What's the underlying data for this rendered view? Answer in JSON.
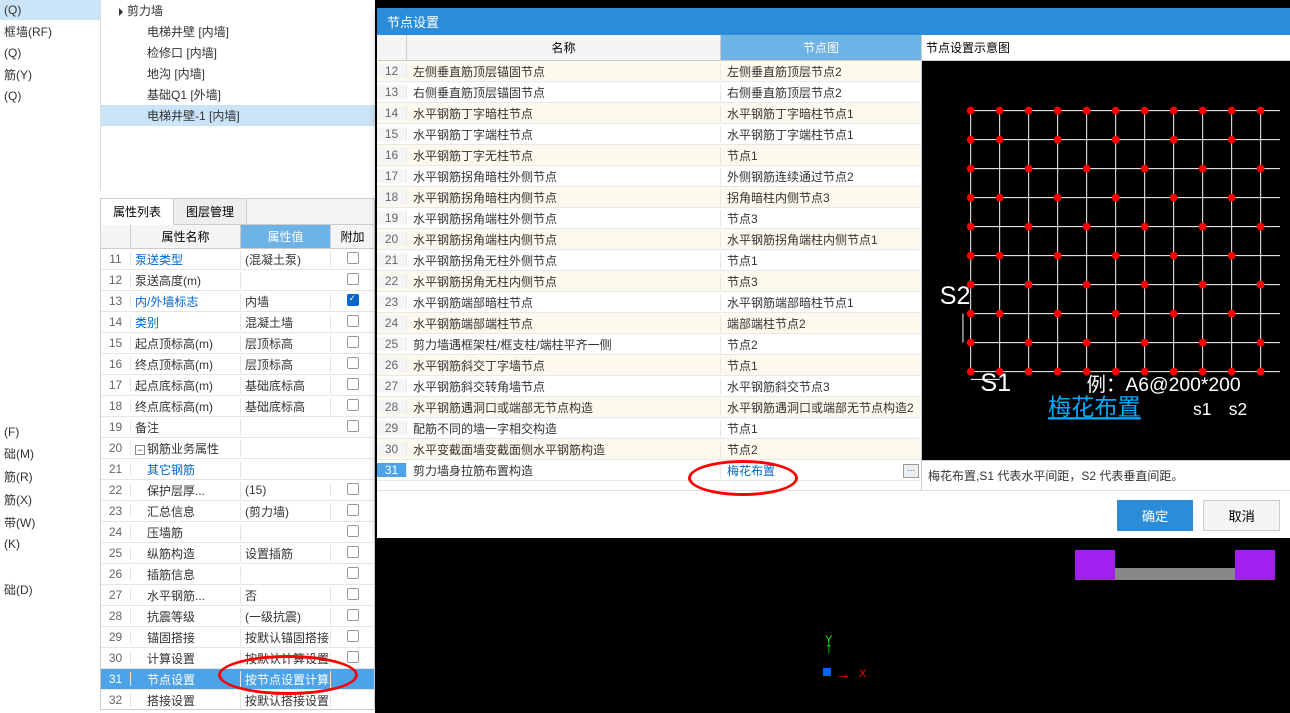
{
  "left_sidebar": {
    "items": [
      {
        "label": "(Q)",
        "sel": true
      },
      {
        "label": "框墙(RF)"
      },
      {
        "label": "(Q)"
      },
      {
        "label": "筋(Y)"
      },
      {
        "label": "(Q)"
      },
      {
        "label": ""
      },
      {
        "label": "(F)"
      },
      {
        "label": "础(M)"
      },
      {
        "label": "筋(R)"
      },
      {
        "label": "筋(X)"
      },
      {
        "label": "带(W)"
      },
      {
        "label": "(K)"
      },
      {
        "label": ""
      },
      {
        "label": "础(D)"
      }
    ]
  },
  "tree": {
    "root": "剪力墙",
    "children": [
      {
        "label": "电梯井壁 [内墙]"
      },
      {
        "label": "检修口 [内墙]"
      },
      {
        "label": "地沟 [内墙]"
      },
      {
        "label": "基础Q1 [外墙]"
      },
      {
        "label": "电梯井壁-1 [内墙]",
        "sel": true
      }
    ]
  },
  "prop_tabs": {
    "t1": "属性列表",
    "t2": "图层管理"
  },
  "prop_header": {
    "name": "属性名称",
    "value": "属性值",
    "extra": "附加"
  },
  "prop_rows": [
    {
      "n": "11",
      "name": "泵送类型",
      "val": "(混凝土泵)",
      "blue": true,
      "chk": false
    },
    {
      "n": "12",
      "name": "泵送高度(m)",
      "val": "",
      "chk": false
    },
    {
      "n": "13",
      "name": "内/外墙标志",
      "val": "内墙",
      "blue": true,
      "chk": true
    },
    {
      "n": "14",
      "name": "类别",
      "val": "混凝土墙",
      "blue": true,
      "chk": false
    },
    {
      "n": "15",
      "name": "起点顶标高(m)",
      "val": "层顶标高",
      "chk": false
    },
    {
      "n": "16",
      "name": "终点顶标高(m)",
      "val": "层顶标高",
      "chk": false
    },
    {
      "n": "17",
      "name": "起点底标高(m)",
      "val": "基础底标高",
      "chk": false
    },
    {
      "n": "18",
      "name": "终点底标高(m)",
      "val": "基础底标高",
      "chk": false
    },
    {
      "n": "19",
      "name": "备注",
      "val": "",
      "chk": false
    },
    {
      "n": "20",
      "name": "钢筋业务属性",
      "val": "",
      "collapse": true
    },
    {
      "n": "21",
      "name": "　其它钢筋",
      "val": "",
      "blue": true
    },
    {
      "n": "22",
      "name": "　保护层厚...",
      "val": "(15)",
      "chk": false
    },
    {
      "n": "23",
      "name": "　汇总信息",
      "val": "(剪力墙)",
      "chk": false
    },
    {
      "n": "24",
      "name": "　压墙筋",
      "val": "",
      "chk": false
    },
    {
      "n": "25",
      "name": "　纵筋构造",
      "val": "设置插筋",
      "chk": false
    },
    {
      "n": "26",
      "name": "　插筋信息",
      "val": "",
      "chk": false
    },
    {
      "n": "27",
      "name": "　水平钢筋...",
      "val": "否",
      "chk": false
    },
    {
      "n": "28",
      "name": "　抗震等级",
      "val": "(一级抗震)",
      "chk": false
    },
    {
      "n": "29",
      "name": "　锚固搭接",
      "val": "按默认锚固搭接...",
      "chk": false
    },
    {
      "n": "30",
      "name": "　计算设置",
      "val": "按默认计算设置...",
      "chk": false
    },
    {
      "n": "31",
      "name": "　节点设置",
      "val": "按节点设置计算 ⋯",
      "sel": true
    },
    {
      "n": "32",
      "name": "　搭接设置",
      "val": "按默认搭接设置..."
    }
  ],
  "dialog": {
    "title": "节点设置",
    "col_name": "名称",
    "col_node": "节点图",
    "rows": [
      {
        "n": "12",
        "name": "左侧垂直筋顶层锚固节点",
        "node": "左侧垂直筋顶层节点2"
      },
      {
        "n": "13",
        "name": "右侧垂直筋顶层锚固节点",
        "node": "右侧垂直筋顶层节点2"
      },
      {
        "n": "14",
        "name": "水平钢筋丁字暗柱节点",
        "node": "水平钢筋丁字暗柱节点1"
      },
      {
        "n": "15",
        "name": "水平钢筋丁字端柱节点",
        "node": "水平钢筋丁字端柱节点1"
      },
      {
        "n": "16",
        "name": "水平钢筋丁字无柱节点",
        "node": "节点1"
      },
      {
        "n": "17",
        "name": "水平钢筋拐角暗柱外侧节点",
        "node": "外侧钢筋连续通过节点2"
      },
      {
        "n": "18",
        "name": "水平钢筋拐角暗柱内侧节点",
        "node": "拐角暗柱内侧节点3"
      },
      {
        "n": "19",
        "name": "水平钢筋拐角端柱外侧节点",
        "node": "节点3"
      },
      {
        "n": "20",
        "name": "水平钢筋拐角端柱内侧节点",
        "node": "水平钢筋拐角端柱内侧节点1"
      },
      {
        "n": "21",
        "name": "水平钢筋拐角无柱外侧节点",
        "node": "节点1"
      },
      {
        "n": "22",
        "name": "水平钢筋拐角无柱内侧节点",
        "node": "节点3"
      },
      {
        "n": "23",
        "name": "水平钢筋端部暗柱节点",
        "node": "水平钢筋端部暗柱节点1"
      },
      {
        "n": "24",
        "name": "水平钢筋端部端柱节点",
        "node": "端部端柱节点2"
      },
      {
        "n": "25",
        "name": "剪力墙遇框架柱/框支柱/端柱平齐一侧",
        "node": "节点2"
      },
      {
        "n": "26",
        "name": "水平钢筋斜交丁字墙节点",
        "node": "节点1"
      },
      {
        "n": "27",
        "name": "水平钢筋斜交转角墙节点",
        "node": "水平钢筋斜交节点3"
      },
      {
        "n": "28",
        "name": "水平钢筋遇洞口或端部无节点构造",
        "node": "水平钢筋遇洞口或端部无节点构造2"
      },
      {
        "n": "29",
        "name": "配筋不同的墙一字相交构造",
        "node": "节点1"
      },
      {
        "n": "30",
        "name": "水平变截面墙变截面侧水平钢筋构造",
        "node": "节点2"
      },
      {
        "n": "31",
        "name": "剪力墙身拉筋布置构造",
        "node": "梅花布置",
        "sel": true
      }
    ],
    "preview_title": "节点设置示意图",
    "preview_s1": "S1",
    "preview_s2": "S2",
    "preview_example": "例：A6@200*200",
    "preview_s1s2": "s1　s2",
    "preview_link": "梅花布置",
    "preview_desc": "梅花布置,S1 代表水平间距，S2 代表垂直间距。",
    "btn_ok": "确定",
    "btn_cancel": "取消"
  },
  "axis": {
    "x": "X",
    "y": "Y"
  }
}
